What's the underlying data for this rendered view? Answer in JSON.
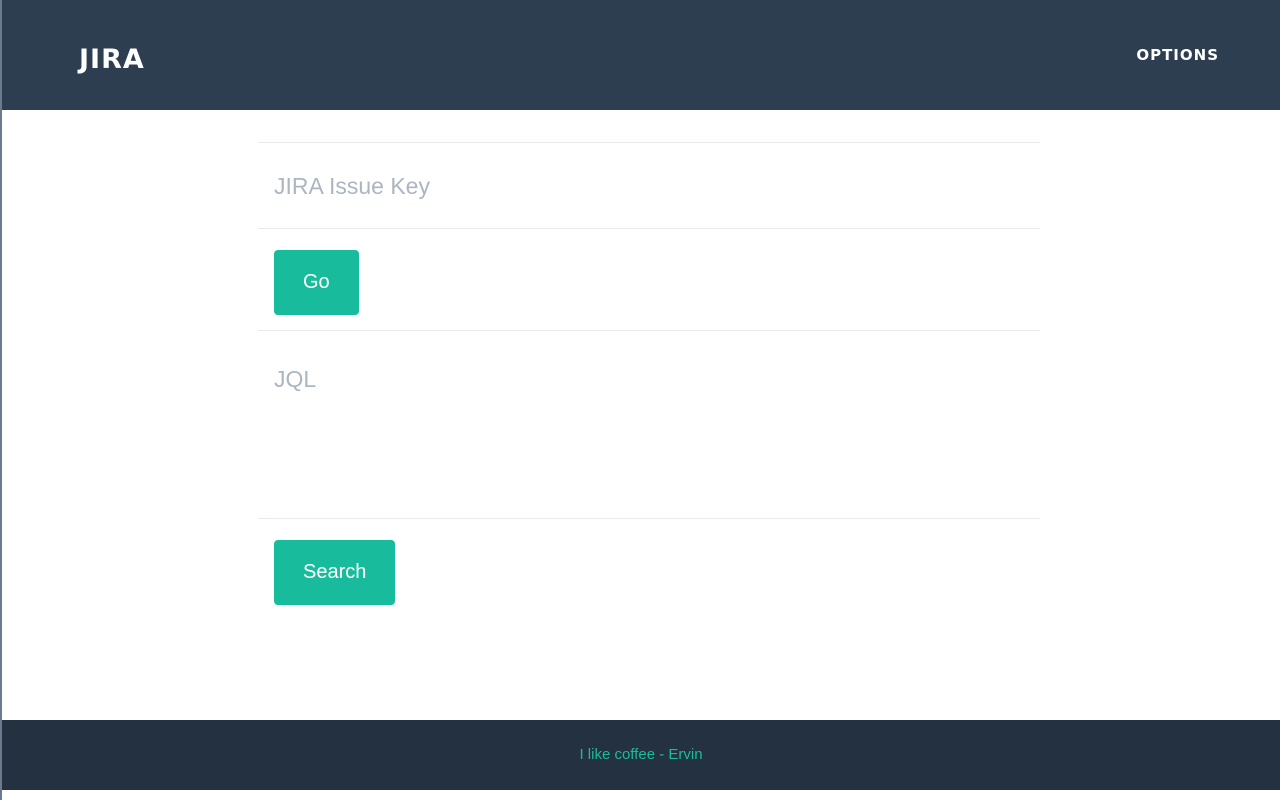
{
  "navbar": {
    "brand": "JIRA",
    "options_label": "OPTIONS"
  },
  "issue_form": {
    "issue_key_placeholder": "JIRA Issue Key",
    "issue_key_value": "",
    "go_label": "Go"
  },
  "jql_form": {
    "jql_placeholder": "JQL",
    "jql_value": "",
    "search_label": "Search"
  },
  "footer": {
    "text": "I like coffee - Ervin"
  },
  "colors": {
    "navbar_bg": "#2c3e50",
    "footer_bg": "#233140",
    "accent": "#18bc9c",
    "placeholder": "#acb6c0"
  }
}
